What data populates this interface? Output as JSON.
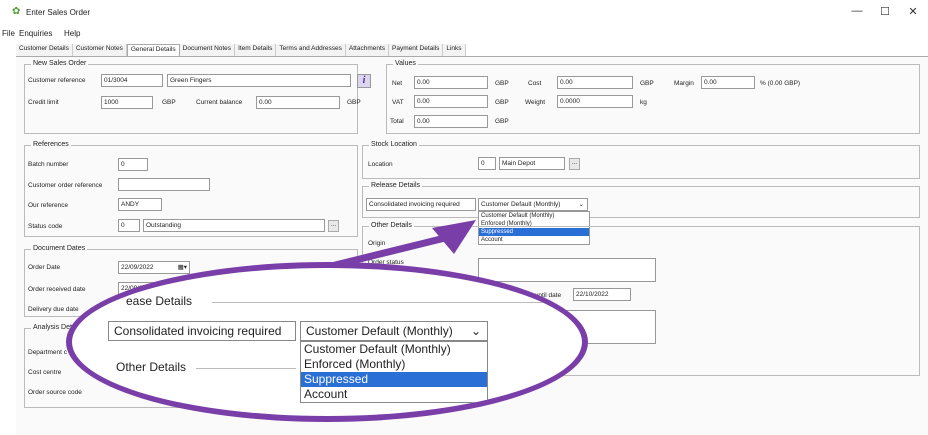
{
  "window": {
    "title": "Enter Sales Order",
    "minimize": "—",
    "maximize": "☐",
    "close": "✕"
  },
  "menu": [
    "File",
    "Enquiries",
    "Help"
  ],
  "tabs": [
    "Customer Details",
    "Customer Notes",
    "General Details",
    "Document Notes",
    "Item Details",
    "Terms and Addresses",
    "Attachments",
    "Payment Details",
    "Links"
  ],
  "active_tab": "General Details",
  "new_sales_order": {
    "legend": "New Sales Order",
    "customer_reference_label": "Customer reference",
    "customer_reference": "01/3004",
    "customer_name": "Green Fingers",
    "credit_limit_label": "Credit limit",
    "credit_limit": "1000",
    "credit_currency": "GBP",
    "current_balance_label": "Current balance",
    "current_balance": "0.00",
    "balance_currency": "GBP"
  },
  "values": {
    "legend": "Values",
    "net_label": "Net",
    "net": "0.00",
    "net_cur": "GBP",
    "cost_label": "Cost",
    "cost": "0.00",
    "cost_cur": "GBP",
    "margin_label": "Margin",
    "margin": "0.00",
    "margin_note": "% (0.00 GBP)",
    "vat_label": "VAT",
    "vat": "0.00",
    "vat_cur": "GBP",
    "weight_label": "Weight",
    "weight": "0.0000",
    "weight_unit": "kg",
    "total_label": "Total",
    "total": "0.00",
    "total_cur": "GBP"
  },
  "references": {
    "legend": "References",
    "batch_label": "Batch number",
    "batch": "0",
    "cust_order_label": "Customer order reference",
    "cust_order": "",
    "our_ref_label": "Our reference",
    "our_ref": "ANDY",
    "status_label": "Status code",
    "status_code": "0",
    "status_text": "Outstanding"
  },
  "stock_location": {
    "legend": "Stock Location",
    "location_label": "Location",
    "location_code": "0",
    "location_name": "Main Depot"
  },
  "release_details": {
    "legend": "Release Details",
    "consolidated_label": "Consolidated invoicing required",
    "selected": "Customer Default (Monthly)",
    "options": [
      "Customer Default (Monthly)",
      "Enforced (Monthly)",
      "Suppressed",
      "Account"
    ],
    "highlighted": "Suppressed"
  },
  "other_details": {
    "legend": "Other Details",
    "origin_label": "Origin",
    "order_status_label": "Order status",
    "valid_until_label": "Valid until date",
    "valid_until": "22/10/2022"
  },
  "document_dates": {
    "legend": "Document Dates",
    "order_date_label": "Order Date",
    "order_date": "22/09/2022",
    "order_received_label": "Order received date",
    "order_received": "22/09/20",
    "delivery_due_label": "Delivery due date"
  },
  "analysis": {
    "legend": "Analysis Detail",
    "department_label": "Department c",
    "cost_centre_label": "Cost centre",
    "order_source_label": "Order source code"
  },
  "zoom": {
    "release_legend": "ease Details",
    "other_legend": "Other Details",
    "consolidated_label": "Consolidated invoicing required",
    "selected": "Customer Default (Monthly)",
    "options": [
      "Customer Default (Monthly)",
      "Enforced (Monthly)",
      "Suppressed",
      "Account"
    ]
  },
  "colors": {
    "highlight": "#2a6fd6",
    "oval": "#7a3ea8",
    "arrow": "#7a3ea8"
  }
}
